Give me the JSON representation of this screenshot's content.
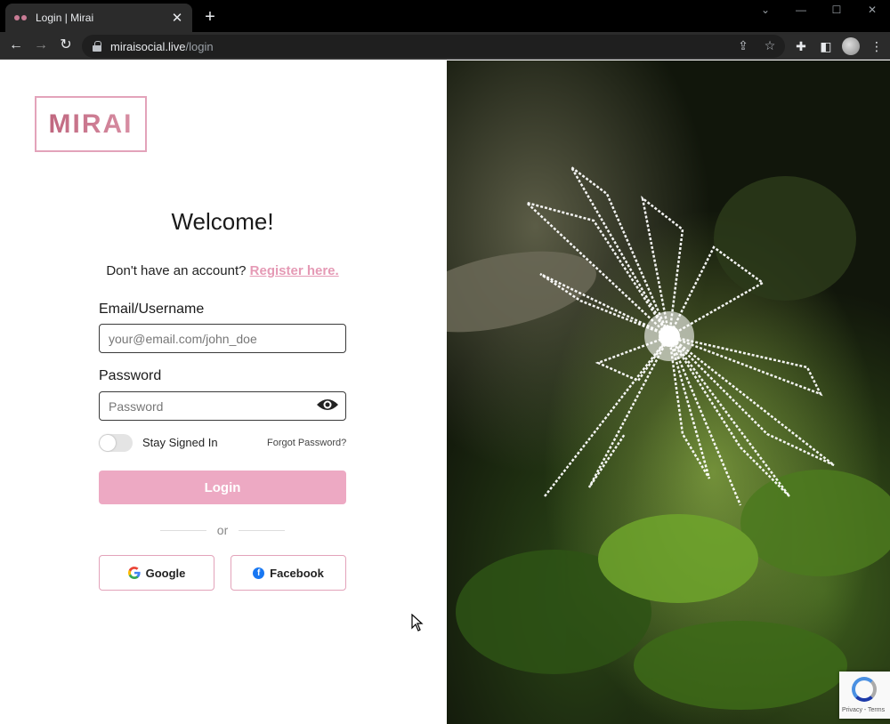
{
  "browser": {
    "tab_title": "Login | Mirai",
    "new_tab": "+",
    "url_host": "miraisocial.live",
    "url_path": "/login"
  },
  "logo": {
    "text": "MIRAI"
  },
  "login": {
    "heading": "Welcome!",
    "no_account_text": "Don't have an account?",
    "register_link": "Register here.",
    "email_label": "Email/Username",
    "email_placeholder": "your@email.com/john_doe",
    "password_label": "Password",
    "password_placeholder": "Password",
    "stay_signed_in": "Stay Signed In",
    "forgot_password": "Forgot Password?",
    "login_button": "Login",
    "divider_text": "or",
    "google_button": "Google",
    "facebook_button": "Facebook"
  },
  "recaptcha": {
    "text": "Privacy - Terms"
  },
  "colors": {
    "accent_pink": "#eda9c3",
    "link_pink": "#e59ab5",
    "logo_border": "#e3a3ba",
    "logo_text": "#c0677f"
  },
  "icons": [
    "back-icon",
    "forward-icon",
    "reload-icon",
    "lock-icon",
    "share-icon",
    "star-icon",
    "extensions-icon",
    "sidepanel-icon",
    "menu-icon",
    "eye-icon",
    "google-icon",
    "facebook-icon",
    "recaptcha-icon"
  ]
}
